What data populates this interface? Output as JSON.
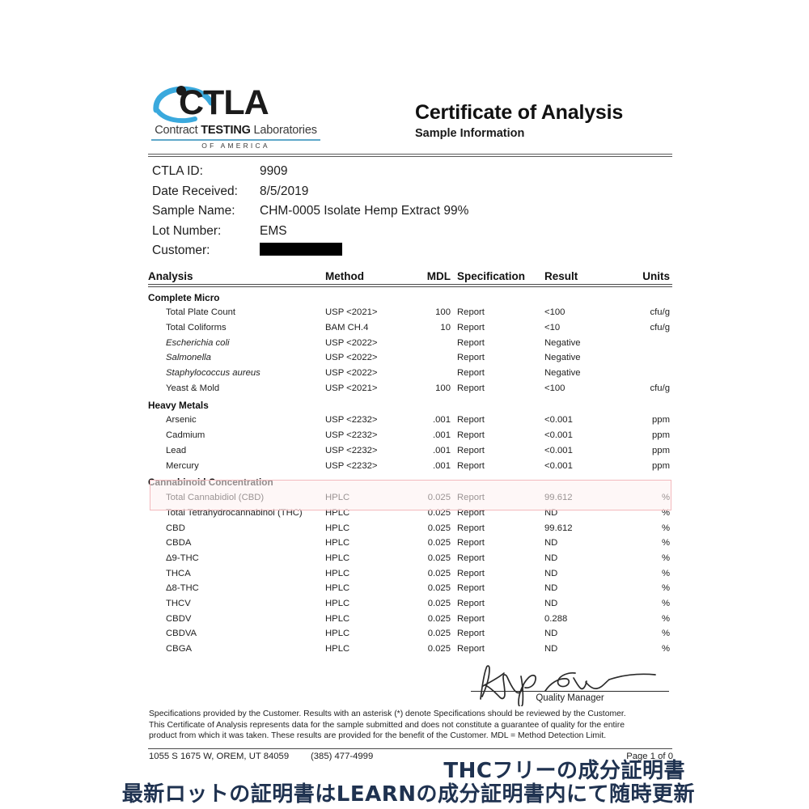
{
  "document": {
    "title": "Certificate of Analysis",
    "subtitle": "Sample Information"
  },
  "logo": {
    "wordmark": "CTLA",
    "line_contract": "Contract ",
    "line_testing": "TESTING",
    "line_laboratories": " Laboratories",
    "country": "OF AMERICA",
    "swoosh_color": "#3aa9dd",
    "wordmark_color": "#1b1b1b"
  },
  "sample_info": [
    {
      "label": "CTLA ID:",
      "value": "9909",
      "redacted": false
    },
    {
      "label": "Date Received:",
      "value": "8/5/2019",
      "redacted": false
    },
    {
      "label": "Sample Name:",
      "value": "CHM-0005 Isolate Hemp Extract 99%",
      "redacted": false
    },
    {
      "label": "Lot Number:",
      "value": "EMS",
      "redacted": false
    },
    {
      "label": "Customer:",
      "value": "",
      "redacted": true
    }
  ],
  "table": {
    "columns": [
      "Analysis",
      "Method",
      "MDL",
      "Specification",
      "Result",
      "Units"
    ],
    "sections": [
      {
        "name": "Complete Micro",
        "rows": [
          {
            "analysis": "Total Plate Count",
            "italic": false,
            "method": "USP <2021>",
            "mdl": "100",
            "spec": "Report",
            "result": "<100",
            "units": "cfu/g"
          },
          {
            "analysis": "Total Coliforms",
            "italic": false,
            "method": "BAM CH.4",
            "mdl": "10",
            "spec": "Report",
            "result": "<10",
            "units": "cfu/g"
          },
          {
            "analysis": "Escherichia coli",
            "italic": true,
            "method": "USP <2022>",
            "mdl": "",
            "spec": "Report",
            "result": "Negative",
            "units": ""
          },
          {
            "analysis": "Salmonella",
            "italic": true,
            "method": "USP <2022>",
            "mdl": "",
            "spec": "Report",
            "result": "Negative",
            "units": ""
          },
          {
            "analysis": "Staphylococcus aureus",
            "italic": true,
            "method": "USP <2022>",
            "mdl": "",
            "spec": "Report",
            "result": "Negative",
            "units": ""
          },
          {
            "analysis": "Yeast & Mold",
            "italic": false,
            "method": "USP <2021>",
            "mdl": "100",
            "spec": "Report",
            "result": "<100",
            "units": "cfu/g"
          }
        ]
      },
      {
        "name": "Heavy Metals",
        "rows": [
          {
            "analysis": "Arsenic",
            "italic": false,
            "method": "USP <2232>",
            "mdl": ".001",
            "spec": "Report",
            "result": "<0.001",
            "units": "ppm"
          },
          {
            "analysis": "Cadmium",
            "italic": false,
            "method": "USP <2232>",
            "mdl": ".001",
            "spec": "Report",
            "result": "<0.001",
            "units": "ppm"
          },
          {
            "analysis": "Lead",
            "italic": false,
            "method": "USP <2232>",
            "mdl": ".001",
            "spec": "Report",
            "result": "<0.001",
            "units": "ppm"
          },
          {
            "analysis": "Mercury",
            "italic": false,
            "method": "USP <2232>",
            "mdl": ".001",
            "spec": "Report",
            "result": "<0.001",
            "units": "ppm"
          }
        ]
      },
      {
        "name": "Cannabinoid Concentration",
        "rows": [
          {
            "analysis": "Total Cannabidiol (CBD)",
            "italic": false,
            "method": "HPLC",
            "mdl": "0.025",
            "spec": "Report",
            "result": "99.612",
            "units": "%",
            "highlighted": true
          },
          {
            "analysis": "Total Tetrahydrocannabinol (THC)",
            "italic": false,
            "method": "HPLC",
            "mdl": "0.025",
            "spec": "Report",
            "result": "ND",
            "units": "%",
            "highlighted": true
          },
          {
            "analysis": "CBD",
            "italic": false,
            "method": "HPLC",
            "mdl": "0.025",
            "spec": "Report",
            "result": "99.612",
            "units": "%"
          },
          {
            "analysis": "CBDA",
            "italic": false,
            "method": "HPLC",
            "mdl": "0.025",
            "spec": "Report",
            "result": "ND",
            "units": "%"
          },
          {
            "analysis": "Δ9-THC",
            "italic": false,
            "method": "HPLC",
            "mdl": "0.025",
            "spec": "Report",
            "result": "ND",
            "units": "%"
          },
          {
            "analysis": "THCA",
            "italic": false,
            "method": "HPLC",
            "mdl": "0.025",
            "spec": "Report",
            "result": "ND",
            "units": "%"
          },
          {
            "analysis": "Δ8-THC",
            "italic": false,
            "method": "HPLC",
            "mdl": "0.025",
            "spec": "Report",
            "result": "ND",
            "units": "%"
          },
          {
            "analysis": "THCV",
            "italic": false,
            "method": "HPLC",
            "mdl": "0.025",
            "spec": "Report",
            "result": "ND",
            "units": "%"
          },
          {
            "analysis": "CBDV",
            "italic": false,
            "method": "HPLC",
            "mdl": "0.025",
            "spec": "Report",
            "result": "0.288",
            "units": "%"
          },
          {
            "analysis": "CBDVA",
            "italic": false,
            "method": "HPLC",
            "mdl": "0.025",
            "spec": "Report",
            "result": "ND",
            "units": "%"
          },
          {
            "analysis": "CBGA",
            "italic": false,
            "method": "HPLC",
            "mdl": "0.025",
            "spec": "Report",
            "result": "ND",
            "units": "%"
          }
        ]
      }
    ],
    "highlight_color": "#f3b9bd"
  },
  "signature": {
    "caption": "Quality Manager"
  },
  "disclaimer": {
    "line1": "Specifications provided by the Customer. Results with an asterisk (*) denote Specifications should be reviewed by the Customer.",
    "line2": "This Certificate of Analysis represents data for the sample submitted and does not constitute a guarantee of quality for the entire",
    "line3": "product from which it was taken. These results are provided for the benefit of the Customer.  MDL = Method Detection Limit."
  },
  "footer": {
    "address": "1055 S 1675 W, OREM, UT 84059",
    "phone": "(385) 477-4999",
    "page": "Page 1 of 0"
  },
  "annotation": {
    "line1": "THCフリーの成分証明書",
    "line2": "最新ロットの証明書はLEARNの成分証明書内にて随時更新",
    "color": "#1f3250"
  }
}
